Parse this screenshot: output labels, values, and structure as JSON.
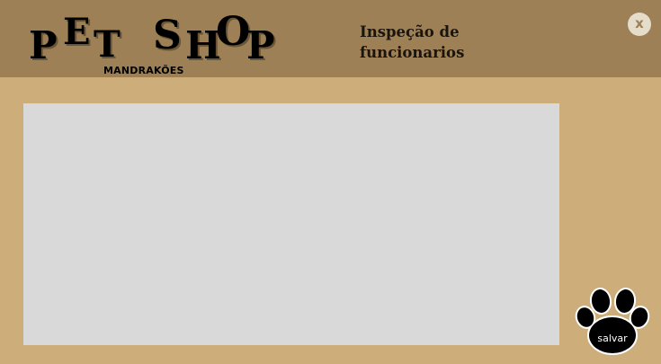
{
  "header": {
    "logo": {
      "letters": [
        "P",
        "E",
        "T",
        "S",
        "H",
        "O",
        "P"
      ],
      "subtitle": "MANDRAKÕES"
    },
    "title": "Inspeção de funcionarios",
    "close_label": "x"
  },
  "save": {
    "label": "salvar"
  },
  "colors": {
    "header_bg": "#9d8055",
    "page_bg": "#cdae7b",
    "panel_bg": "#d9d9d9"
  }
}
